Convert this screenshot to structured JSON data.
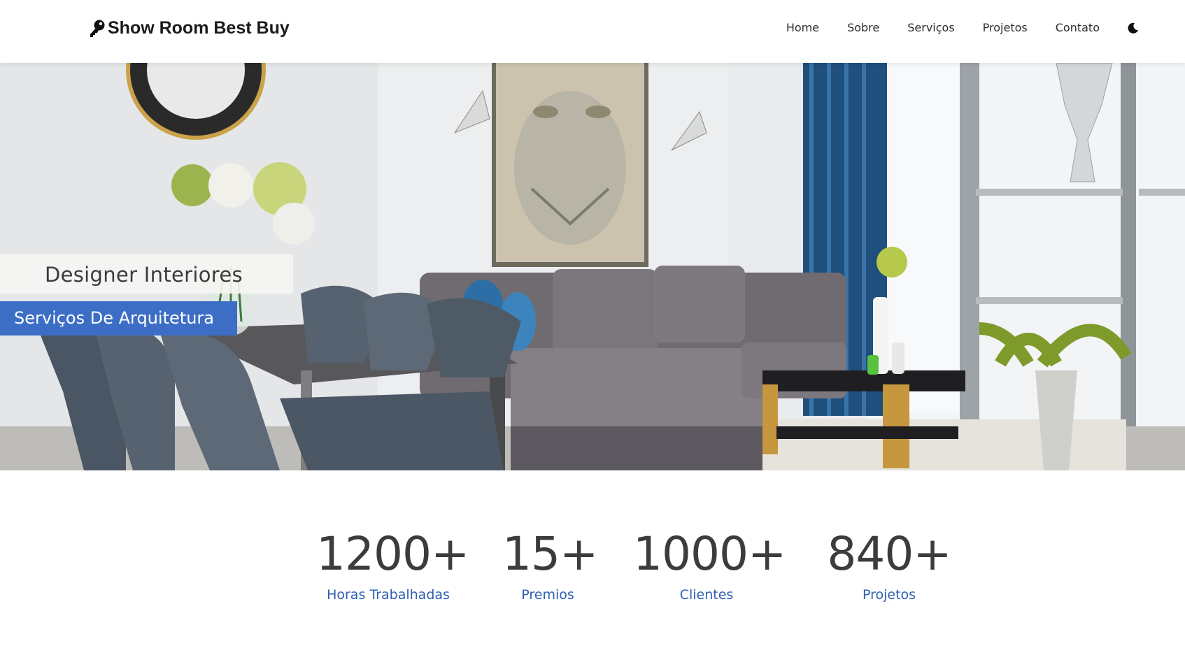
{
  "header": {
    "brand": "Show Room Best Buy",
    "nav": [
      "Home",
      "Sobre",
      "Serviços",
      "Projetos",
      "Contato"
    ],
    "theme_toggle_icon": "moon-icon"
  },
  "hero": {
    "title": "Designer Interiores",
    "subtitle": "Serviços De Arquitetura",
    "accent_color": "#3d6ec6"
  },
  "stats": [
    {
      "value": "1200+",
      "label": "Horas Trabalhadas"
    },
    {
      "value": "15+",
      "label": "Premios"
    },
    {
      "value": "1000+",
      "label": "Clientes"
    },
    {
      "value": "840+",
      "label": "Projetos"
    }
  ],
  "colors": {
    "stat_label": "#2f5fb0",
    "stat_number": "#3c3c3c"
  }
}
